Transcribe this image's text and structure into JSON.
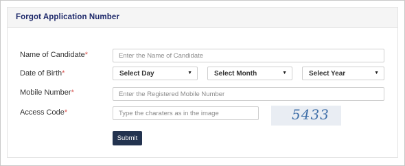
{
  "form": {
    "title": "Forgot Application Number",
    "name": {
      "label": "Name of Candidate",
      "placeholder": "Enter the Name of Candidate"
    },
    "dob": {
      "label": "Date of Birth",
      "day": "Select Day",
      "month": "Select Month",
      "year": "Select Year"
    },
    "mobile": {
      "label": "Mobile Number",
      "placeholder": "Enter the Registered Mobile Number"
    },
    "access": {
      "label": "Access Code",
      "placeholder": "Type the charaters as in the image"
    },
    "captcha_text": "5433",
    "required_mark": "*",
    "submit": "Submit"
  },
  "icons": {
    "dropdown": "caret-down-icon"
  }
}
